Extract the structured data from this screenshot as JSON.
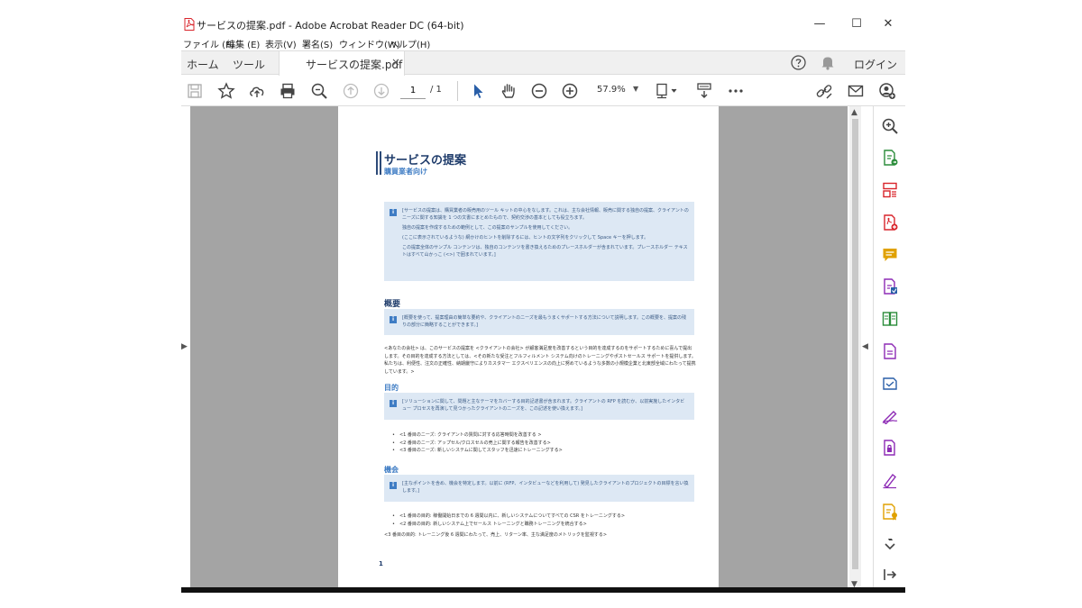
{
  "window": {
    "title": "サービスの提案.pdf - Adobe Acrobat Reader DC (64-bit)",
    "minimize": "—",
    "maximize": "☐",
    "close": "✕"
  },
  "menu": [
    "ファイル (F)",
    "編集 (E)",
    "表示(V)",
    "署名(S)",
    "ウィンドウ(W)",
    "ヘルプ(H)"
  ],
  "tabs": {
    "home": "ホーム",
    "tools": "ツール",
    "document": "サービスの提案.pdf",
    "close": "×",
    "login": "ログイン"
  },
  "toolbar": {
    "current_page": "1",
    "page_total": "/  1",
    "zoom": "57.9%"
  },
  "document": {
    "title": "サービスの提案",
    "subtitle": "購買業者向け",
    "intro_note": [
      "[サービスの提案は、購買業者の販売用のツール キットの中心をなします。これは、主な会社情報、販売に関する独自の提案、クライアントのニーズに関する知識を 1 つの文書にまとめたもので、契約交渉の基本としても役立ちます。",
      "独自の提案を作成するための範例として、この提案のサンプルを使用してください。",
      "(ここに表示されているような) 網かけのヒントを削除するには、ヒントの文字列をクリックして Space キーを押します。",
      "この提案全体のサンプル コンテンツは、独自のコンテンツを書き換えるためのプレースホルダーが含まれています。プレースホルダー テキストはすべて山かっこ (<>) で囲まれています。]"
    ],
    "overview_heading": "概要",
    "overview_note": "[概要を使って、提案理由の簡単な要約や、クライアントのニーズを最もうまくサポートする方法について説明します。この概要を、提案の残りの部分に簡略することができます。]",
    "overview_text": "<あなたの会社> は、このサービスの提案を <クライアントの会社> が顧客満足度を改善するという目的を達成するのをサポートするために喜んで提出します。その目的を達成する方法としては、<その新たな受注とフルフィルメント システム向けのトレーニングやポストセールス サポートを提供します。私たちは、利便性、注文の正確性、納期厳守によりカスタマー エクスペリエンスの向上に努めているような多数の小規模企業と北東部全域にわたって提携しています。>",
    "objectives_heading": "目的",
    "objectives_note": "[ソリューションに関して、問題と主なテーマをカバーする目的記述書が含まれます。クライアントの RFP を読むか、以前実施したインタビュー プロセスを再演して見つかったクライアントのニーズを、この記述を使い換えます。]",
    "objectives": [
      "<1 番目のニーズ: クライアントの質問に対する応答時間を改善する >",
      "<2 番目のニーズ: アップセル/クロスセルの売上に関する報告を改善する>",
      "<3 番目のニーズ: 新しいシステムに関してスタッフを迅速にトレーニングする>"
    ],
    "opportunity_heading": "機会",
    "opportunity_note": "[主なポイントを含め、機会を特定します。以前に (RFP、インタビューなどを利用して) 発見したクライアントのプロジェクトの目標を言い換します。]",
    "opportunities": [
      "<1 番目の目的: 稼働開始日までの 6 週間以内に、新しいシステムについてすべての CSR をトレーニングする>",
      "<2 番目の目的: 新しいシステム上でセールス トレーニングと職務トレーニングを統合する>"
    ],
    "third_objective": "<3 番目の目的: トレーニング後 6 週間にわたって、売上、リターン率、主な満足度のメトリックを監視する>",
    "page_number": "1"
  },
  "colors": {
    "accent": "#3e7cc4",
    "title": "#1f3c6b",
    "note_bg": "#dde8f4",
    "acrobat_red": "#d9242b",
    "rp_green": "#2a8c3a",
    "rp_purple": "#8d2bb5",
    "rp_orange": "#e0a100"
  }
}
